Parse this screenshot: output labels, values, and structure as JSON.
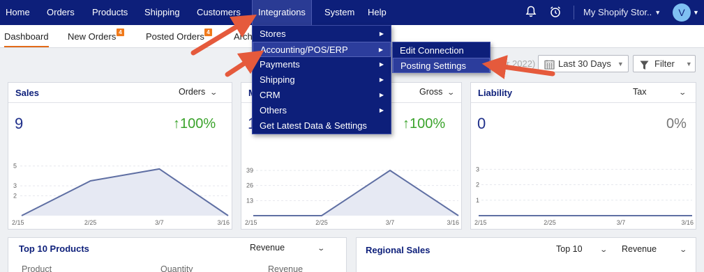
{
  "nav": {
    "items": [
      "Home",
      "Orders",
      "Products",
      "Shipping",
      "Customers",
      "Integrations",
      "System",
      "Help"
    ],
    "store_selector": "My Shopify Stor..",
    "avatar_initial": "V"
  },
  "subtabs": [
    {
      "label": "Dashboard"
    },
    {
      "label": "New Orders",
      "badge": "4"
    },
    {
      "label": "Posted Orders",
      "badge": "4"
    },
    {
      "label": "Arch"
    }
  ],
  "controls": {
    "date_range_text": "Mar 2022)",
    "period_label": "Last 30 Days",
    "filter_label": "Filter"
  },
  "cards": {
    "sales": {
      "title": "Sales",
      "metric": "Orders",
      "value": "9",
      "change": "100%"
    },
    "middle": {
      "title": "M",
      "metric": "Gross",
      "value": "1",
      "change": "100%"
    },
    "liability": {
      "title": "Liability",
      "metric": "Tax",
      "value": "0",
      "change": "0%"
    },
    "top_products": {
      "title": "Top 10 Products",
      "metric": "Revenue",
      "columns": [
        "Product",
        "Quantity",
        "Revenue"
      ]
    },
    "regional": {
      "title": "Regional Sales",
      "top_select": "Top 10",
      "metric": "Revenue"
    }
  },
  "chart_data": [
    {
      "type": "area",
      "x": [
        "2/15",
        "2/25",
        "3/7",
        "3/16"
      ],
      "y": [
        0,
        3.5,
        4.7,
        0
      ],
      "yticks": [
        "5",
        "3",
        "2"
      ],
      "ylim": [
        0,
        5.6
      ]
    },
    {
      "type": "area",
      "x": [
        "2/15",
        "2/25",
        "3/7",
        "3/16"
      ],
      "y": [
        0,
        0,
        39,
        0
      ],
      "yticks": [
        "39",
        "26",
        "13"
      ],
      "ylim": [
        0,
        48
      ]
    },
    {
      "type": "area",
      "x": [
        "2/15",
        "2/25",
        "3/7",
        "3/16"
      ],
      "y": [
        0,
        0,
        0,
        0
      ],
      "yticks": [
        "3",
        "2",
        "1"
      ],
      "ylim": [
        0,
        3.6
      ]
    }
  ],
  "integrations_menu": {
    "items": [
      {
        "label": "Stores",
        "submenu": true
      },
      {
        "label": "Accounting/POS/ERP",
        "submenu": true
      },
      {
        "label": "Payments",
        "submenu": true
      },
      {
        "label": "Shipping",
        "submenu": true
      },
      {
        "label": "CRM",
        "submenu": true
      },
      {
        "label": "Others",
        "submenu": true
      },
      {
        "label": "Get Latest Data & Settings",
        "submenu": false
      }
    ],
    "submenu_items": [
      "Edit Connection",
      "Posting Settings"
    ]
  },
  "colors": {
    "nav_bg": "#0d1f7a",
    "accent": "#e36a18",
    "positive": "#3aa32b",
    "chart_line": "#5f6fa3",
    "chart_fill": "#e6e9f3",
    "annotation_arrow": "#e55a3c"
  }
}
